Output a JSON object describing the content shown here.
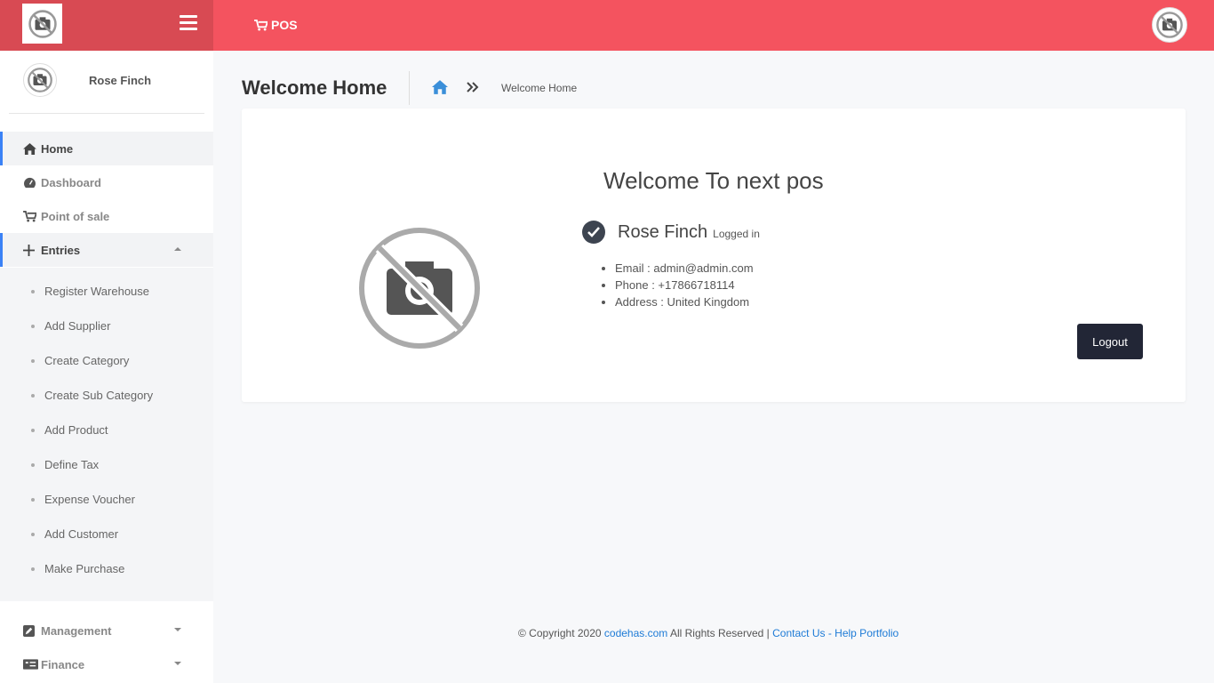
{
  "topbar": {
    "pos_label": "POS",
    "accent": "#f4535f",
    "brand_bg": "#d84a53"
  },
  "sidebar": {
    "user_name": "Rose Finch",
    "nav": {
      "home": "Home",
      "dashboard": "Dashboard",
      "point_of_sale": "Point of sale",
      "entries": "Entries",
      "management": "Management",
      "finance": "Finance"
    },
    "entries_items": [
      "Register Warehouse",
      "Add Supplier",
      "Create Category",
      "Create Sub Category",
      "Add Product",
      "Define Tax",
      "Expense Voucher",
      "Add Customer",
      "Make Purchase"
    ]
  },
  "header": {
    "title": "Welcome Home",
    "breadcrumb_current": "Welcome Home"
  },
  "card": {
    "welcome": "Welcome To next pos",
    "user_name": "Rose Finch",
    "status": "Logged in",
    "info": [
      "Email : admin@admin.com",
      "Phone : +17866718114",
      "Address : United Kingdom"
    ],
    "logout_label": "Logout"
  },
  "footer": {
    "copyright": "© Copyright 2020",
    "site_link": "codehas.com",
    "rights": "All Rights Reserved |",
    "contact": "Contact Us",
    "dash": "-",
    "help": "Help Portfolio"
  }
}
